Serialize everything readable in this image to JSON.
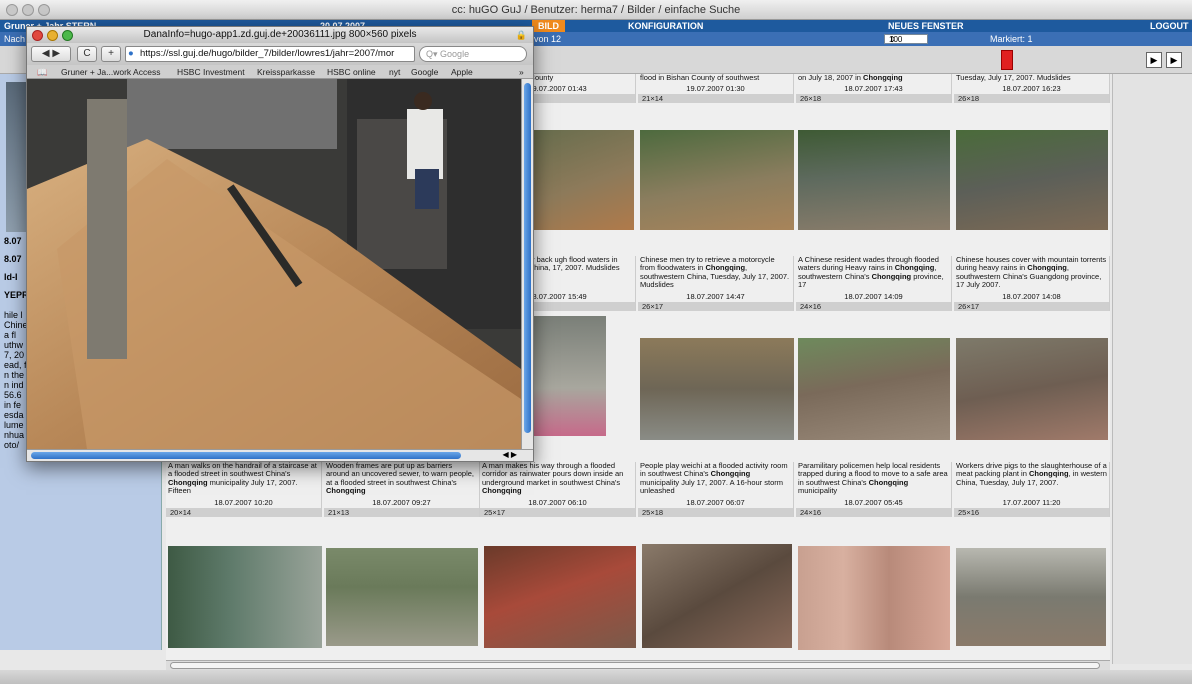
{
  "main_window": {
    "title": "cc: huGO GuJ / Benutzer: herma7 / Bilder / einfache Suche"
  },
  "navbar": {
    "left_label": "Gruner + Jahr STERN",
    "date": "20.07.2007",
    "bild": "BILD",
    "konfiguration": "KONFIGURATION",
    "neues_fenster": "NEUES FENSTER",
    "logout": "LOGOUT"
  },
  "subbar": {
    "left_label": "Nach",
    "page_info": "von 12",
    "zoom_value": "100",
    "markiert": "Markiert: 1"
  },
  "left_panel": {
    "lines": [
      "8.07",
      "8.07",
      "ld-I",
      "YEPR",
      "hile l",
      "Chine",
      "a fl",
      "uthw",
      "7, 20",
      "ead, f",
      "n the",
      "n ind",
      "56.6",
      "in fe",
      "esda",
      "lume",
      "nhua",
      "oto/"
    ]
  },
  "popup": {
    "title": "DanaInfo=hugo-app1.zd.guj.de+20036111.jpg 800×560 pixels",
    "url": "https://ssl.guj.de/hugo/bilder_7/bilder/lowres1/jahr=2007/mor",
    "search_placeholder": "Google",
    "back_label": "◀ ▶",
    "reload_label": "C",
    "add_label": "+",
    "bookmarks": [
      "Gruner + Ja...work Access",
      "HSBC Investment",
      "Kreissparkasse",
      "HSBC online",
      "nyt",
      "Google",
      "Apple"
    ]
  },
  "grid": {
    "row1_captions": [
      {
        "text": "one in Bishan County",
        "date": "19.07.2007 01:43",
        "size": ""
      },
      {
        "text": "flood in Bishan County of southwest",
        "date": "19.07.2007 01:30",
        "size": "21×14"
      },
      {
        "text": "on July 18, 2007 in Chongqing",
        "date": "18.07.2007 17:43",
        "size": "26×18"
      },
      {
        "text": "Tuesday, July 17, 2007. Mudslides",
        "date": "18.07.2007 16:23",
        "size": "26×18"
      }
    ],
    "row2_captions": [
      {
        "text": "e workers piggy back ugh flood waters in southwestern China, 17, 2007. Mudslides",
        "date": "18.07.2007 15:49",
        "size": ""
      },
      {
        "text": "Chinese men try to retrieve a motorcycle from floodwaters in Chongqing, southwestern China, Tuesday, July 17, 2007. Mudslides",
        "date": "18.07.2007 14:47",
        "size": "26×17"
      },
      {
        "text": "A Chinese resident wades through flooded waters during Heavy rains in Chongqing, southwestern China's Chongqing province, 17",
        "date": "18.07.2007 14:09",
        "size": "24×16"
      },
      {
        "text": "Chinese houses cover with mountain torrents during heavy rains in Chongqing, southwestern China's Guangdong province, 17 July 2007.",
        "date": "18.07.2007 14:08",
        "size": "26×17"
      }
    ],
    "row3_captions": [
      {
        "text": "A man walks on the handrail of a staircase at a flooded street in southwest China's Chongqing municipality July 17, 2007. Fifteen",
        "date": "18.07.2007 10:20",
        "size": "20×14"
      },
      {
        "text": "Wooden frames are put up as barriers around an uncovered sewer, to warn people, at a flooded street in southwest China's Chongqing",
        "date": "18.07.2007 09:27",
        "size": "21×13"
      },
      {
        "text": "A man makes his way through a flooded corridor as rainwater pours down inside an underground market in southwest China's Chongqing",
        "date": "18.07.2007 06:10",
        "size": "25×17"
      },
      {
        "text": "People play weichi at a flooded activity room in southwest China's Chongqing municipality July 17, 2007. A 16-hour storm unleashed",
        "date": "18.07.2007 06:07",
        "size": "25×18"
      },
      {
        "text": "Paramilitary policemen help local residents trapped during a flood to move to a safe area in southwest China's Chongqing municipality",
        "date": "18.07.2007 05:45",
        "size": "24×16"
      },
      {
        "text": "Workers drive pigs to the slaughterhouse of a meat packing plant in Chongqing, in western China, Tuesday, July 17, 2007.",
        "date": "17.07.2007 11:20",
        "size": "25×16"
      }
    ]
  }
}
